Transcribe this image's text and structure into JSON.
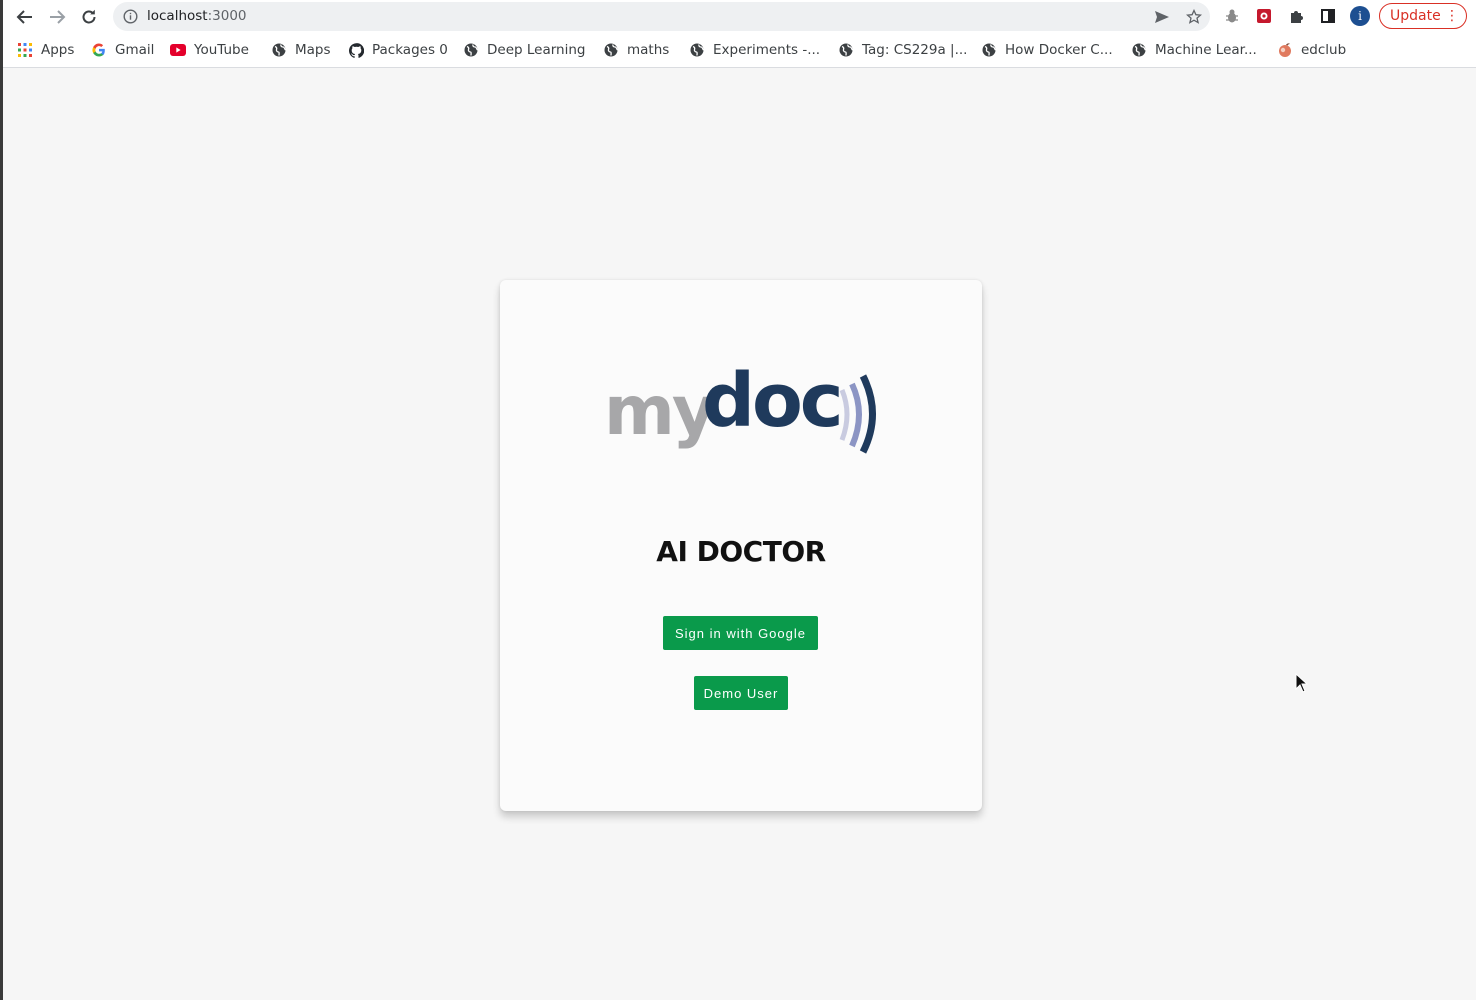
{
  "browser": {
    "url_host": "localhost",
    "url_port": ":3000",
    "update_label": "Update",
    "profile_initial": "i"
  },
  "bookmarks": [
    {
      "label": "Apps",
      "icon": "apps-grid-icon"
    },
    {
      "label": "Gmail",
      "icon": "google-icon"
    },
    {
      "label": "YouTube",
      "icon": "youtube-icon"
    },
    {
      "label": "Maps",
      "icon": "globe-icon"
    },
    {
      "label": "Packages 0",
      "icon": "github-icon"
    },
    {
      "label": "Deep Learning",
      "icon": "globe-icon"
    },
    {
      "label": "maths",
      "icon": "globe-icon"
    },
    {
      "label": "Experiments -...",
      "icon": "globe-icon"
    },
    {
      "label": "Tag: CS229a |...",
      "icon": "globe-icon"
    },
    {
      "label": "How Docker C...",
      "icon": "globe-icon"
    },
    {
      "label": "Machine Lear...",
      "icon": "globe-icon"
    },
    {
      "label": "edclub",
      "icon": "edclub-icon"
    }
  ],
  "page": {
    "logo": {
      "text_gray": "my",
      "text_navy": "doc"
    },
    "title": "AI DOCTOR",
    "google_button": "Sign in with Google",
    "demo_button": "Demo User"
  },
  "colors": {
    "button_green": "#0a9a4b",
    "logo_gray": "#a7a7a9",
    "logo_navy": "#1f3a5c",
    "update_red": "#d93025"
  }
}
